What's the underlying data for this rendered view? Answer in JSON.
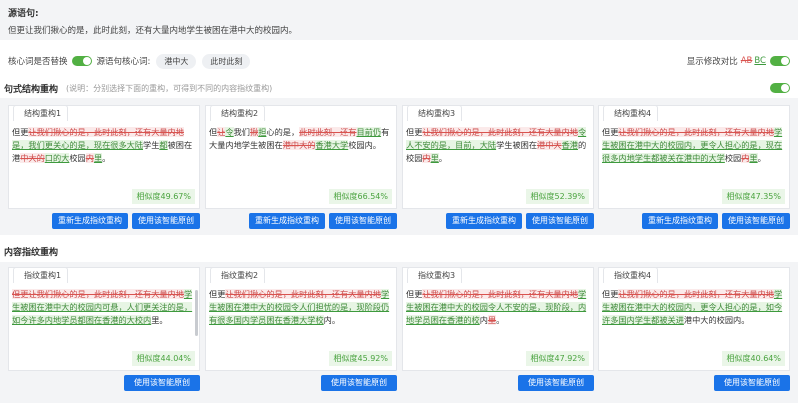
{
  "source": {
    "title": "源语句:",
    "text": "但更让我们揪心的是，此时此刻，还有大量内地学生被困在港中大的校园内。"
  },
  "options": {
    "replace_label": "核心词是否替换",
    "core_label": "源语句核心词:",
    "core_tags": [
      "港中大",
      "此时此刻"
    ],
    "diff_label": "显示修改对比",
    "diff_ab": "AB",
    "diff_bc": "BC"
  },
  "structure": {
    "title": "句式结构重构",
    "note": "(说明：分别选择下面的重构，可得到不同的内容指纹重构)",
    "cards": [
      {
        "tab": "结构重构1",
        "segments": [
          {
            "t": "n",
            "s": "但更"
          },
          {
            "t": "d",
            "s": "让我们揪心的是，此时此刻，还有大量内地"
          },
          {
            "t": "i",
            "s": "是，我们更关心的是，现在很多大陆"
          },
          {
            "t": "n",
            "s": "学生"
          },
          {
            "t": "i",
            "s": "都"
          },
          {
            "t": "n",
            "s": "被困在港"
          },
          {
            "t": "d",
            "s": "中大的"
          },
          {
            "t": "i",
            "s": "口的大"
          },
          {
            "t": "n",
            "s": "校园"
          },
          {
            "t": "d",
            "s": "内"
          },
          {
            "t": "i",
            "s": "里"
          },
          {
            "t": "n",
            "s": "。"
          }
        ],
        "similarity": "相似度49.67%",
        "btn_regen": "重新生成指纹重构",
        "btn_use": "使用该智能原创"
      },
      {
        "tab": "结构重构2",
        "segments": [
          {
            "t": "n",
            "s": "但"
          },
          {
            "t": "d",
            "s": "让"
          },
          {
            "t": "i",
            "s": "令"
          },
          {
            "t": "n",
            "s": "我们"
          },
          {
            "t": "d",
            "s": "揪"
          },
          {
            "t": "i",
            "s": "担"
          },
          {
            "t": "n",
            "s": "心的是，"
          },
          {
            "t": "d",
            "s": "此时此刻，还有"
          },
          {
            "t": "i",
            "s": "目前仍"
          },
          {
            "t": "n",
            "s": "有大量内地学生被困在"
          },
          {
            "t": "d",
            "s": "港中大的"
          },
          {
            "t": "i",
            "s": "香港大学"
          },
          {
            "t": "n",
            "s": "校园内。"
          }
        ],
        "similarity": "相似度66.54%",
        "btn_regen": "重新生成指纹重构",
        "btn_use": "使用该智能原创"
      },
      {
        "tab": "结构重构3",
        "segments": [
          {
            "t": "n",
            "s": "但更"
          },
          {
            "t": "d",
            "s": "让我们揪心的是，此时此刻，还有大量内地"
          },
          {
            "t": "i",
            "s": "令人不安的是，目前，大陆"
          },
          {
            "t": "n",
            "s": "学生被困在"
          },
          {
            "t": "d",
            "s": "港中大"
          },
          {
            "t": "i",
            "s": "香港"
          },
          {
            "t": "n",
            "s": "的校园"
          },
          {
            "t": "d",
            "s": "内"
          },
          {
            "t": "i",
            "s": "里"
          },
          {
            "t": "n",
            "s": "。"
          }
        ],
        "similarity": "相似度52.39%",
        "btn_regen": "重新生成指纹重构",
        "btn_use": "使用该智能原创"
      },
      {
        "tab": "结构重构4",
        "segments": [
          {
            "t": "n",
            "s": "但更"
          },
          {
            "t": "d",
            "s": "让我们揪心的是，此时此刻，还有大量内地"
          },
          {
            "t": "i",
            "s": "学生被困在港中大的校园内，更令人担心的是，现在很多内地学生都被关在港中的大学"
          },
          {
            "t": "n",
            "s": "校园"
          },
          {
            "t": "d",
            "s": "内"
          },
          {
            "t": "i",
            "s": "里"
          },
          {
            "t": "n",
            "s": "。"
          }
        ],
        "similarity": "相似度47.35%",
        "btn_regen": "重新生成指纹重构",
        "btn_use": "使用该智能原创"
      }
    ]
  },
  "content": {
    "title": "内容指纹重构",
    "cards": [
      {
        "tab": "指纹重构1",
        "segments": [
          {
            "t": "d",
            "s": "但更让我们揪心的是，此时此刻，还有大量内地"
          },
          {
            "t": "i",
            "s": "学生被困在港中大的校园内可悬，人们更关注的是，如今许多内地学员都困在香港的大校内"
          },
          {
            "t": "n",
            "s": "里。"
          }
        ],
        "similarity": "相似度44.04%",
        "btn_use": "使用该智能原创"
      },
      {
        "tab": "指纹重构2",
        "segments": [
          {
            "t": "n",
            "s": "但更"
          },
          {
            "t": "d",
            "s": "让我们揪心的是，此时此刻，还有大量内地"
          },
          {
            "t": "i",
            "s": "学生被困在港中大的校园令人们担忧的是，现阶段仍有很多国内学员困在香港大学校"
          },
          {
            "t": "n",
            "s": "内。"
          }
        ],
        "similarity": "相似度45.92%",
        "btn_use": "使用该智能原创"
      },
      {
        "tab": "指纹重构3",
        "segments": [
          {
            "t": "n",
            "s": "但更"
          },
          {
            "t": "d",
            "s": "让我们揪心的是，此时此刻，还有大量内地"
          },
          {
            "t": "i",
            "s": "学生被困在港中大的校园令人不安的是，现阶段，内地学员困在香港的校"
          },
          {
            "t": "n",
            "s": "内"
          },
          {
            "t": "d",
            "s": "里"
          },
          {
            "t": "n",
            "s": "。"
          }
        ],
        "similarity": "相似度47.92%",
        "btn_use": "使用该智能原创"
      },
      {
        "tab": "指纹重构4",
        "segments": [
          {
            "t": "n",
            "s": "但更"
          },
          {
            "t": "d",
            "s": "让我们揪心的是，此时此刻，还有大量内地"
          },
          {
            "t": "i",
            "s": "学生被困在港中大的校园内，更令人担心的是，如今许多国内学生都被关进"
          },
          {
            "t": "n",
            "s": "港中大的校园内。"
          }
        ],
        "similarity": "相似度40.64%",
        "btn_use": "使用该智能原创"
      }
    ]
  }
}
